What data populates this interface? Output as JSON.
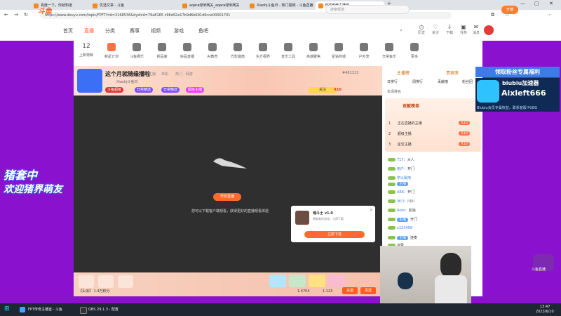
{
  "browser": {
    "tabs": [
      {
        "label": "百度一下，你就知道",
        "active": false
      },
      {
        "label": "优选文章 - 斗鱼",
        "active": false
      },
      {
        "label": "aqara绿米网关_aqara绿米网关",
        "active": false
      },
      {
        "label": "Xiaohj斗鱼日 - 热门视频 - 斗鱼直播",
        "active": false
      },
      {
        "label": "FPT传奇主播室",
        "active": true
      }
    ],
    "url": "https://www.douyu.com/topic/FPFT?rid=3168536&dyshid=79a8165 c96d92a17b9d6b691d6cce00001701"
  },
  "site": {
    "logo": "斗鱼",
    "nav": [
      "首页",
      "直播",
      "分类",
      "赛事",
      "视频",
      "游戏",
      "鱼吧"
    ],
    "nav_active": "直播",
    "search_placeholder": "搜索频道",
    "header_icons": [
      "历史",
      "关注",
      "下载",
      "任务",
      "消息"
    ],
    "open_button": "开播"
  },
  "categories": [
    {
      "top": "12",
      "label": "上新特辑"
    },
    {
      "label": "新星计划"
    },
    {
      "label": "斗鱼娱乐"
    },
    {
      "label": "新品速"
    },
    {
      "label": "好品直播"
    },
    {
      "label": "AI教育"
    },
    {
      "label": "光影盛典"
    },
    {
      "label": "东方视界"
    },
    {
      "label": "音乐工具"
    },
    {
      "label": "高端聚焦"
    },
    {
      "label": "星钻商城"
    },
    {
      "label": "户外宠"
    },
    {
      "label": "日常鱼乐"
    },
    {
      "label": "更多"
    }
  ],
  "room": {
    "title": "这个月就随缘播啦",
    "streamer": "Xiaohj斗鱼日",
    "tags": [
      "主播",
      "单机",
      "热门 · 网游"
    ],
    "badges": [
      "斗鱼超级",
      "日常精选",
      "日常精选",
      "超级主播"
    ],
    "viewer_hint": "#481113",
    "follow_label": "关注",
    "follow_count": "X10",
    "room_open_button": "开启直播",
    "player_hint": "您可以下载客户端观看，获得更好的直播观看体验",
    "popup": {
      "title": "魂斗士 v1.0",
      "desc": "勇敢者的游戏，立即下载",
      "button": "立即下载"
    },
    "gift_text": "【头衔】 1.4万积分",
    "gift_count": "1.4704",
    "fish_balls": "1.123",
    "charge_button": "充值",
    "send_button": "发送"
  },
  "side": {
    "tabs": [
      "主播榜",
      "贵宾席"
    ],
    "subtabs": [
      "日排行",
      "周排行",
      "贡献榜",
      "粉丝团"
    ],
    "rank_label": "本场排名",
    "rank_card_title": "贡献榜单",
    "rank_card_rows": [
      {
        "rank": "1",
        "name": "正在直播的主播",
        "score": "X10"
      },
      {
        "rank": "2",
        "name": "超级主播",
        "score": "X10"
      },
      {
        "rank": "3",
        "name": "星空主播",
        "score": "X10"
      }
    ],
    "chat": [
      {
        "badge": "",
        "nick": "717",
        "text": "大人"
      },
      {
        "badge": "",
        "nick": "用户",
        "text": "开门"
      },
      {
        "badge": "",
        "nick": "学以致用",
        "text": ""
      },
      {
        "badge": "主播",
        "nick": "",
        "text": ""
      },
      {
        "badge": "",
        "nick": "ARK",
        "text": "开门"
      },
      {
        "badge": "",
        "nick": "冰川",
        "text": "川川"
      },
      {
        "badge": "",
        "nick": "Aron",
        "text": "加油"
      },
      {
        "badge": "主播",
        "nick": "",
        "text": "开门"
      },
      {
        "badge": "",
        "nick": "x123456",
        "text": ""
      },
      {
        "badge": "主播",
        "nick": "",
        "text": "连麦"
      },
      {
        "badge": "",
        "nick": "",
        "text": "点赞"
      }
    ]
  },
  "overlays": {
    "fan_title": "领取粉丝专属福利",
    "fan_brand": "biubiu加速器",
    "fan_name": "Aixleft666",
    "fan_sub": "Biubiu会员专属权益，联系客服 PUBG",
    "left_line1": "猪套中",
    "left_line2": "欢迎猪界萌友",
    "right_logo": "斗鱼直播"
  },
  "taskbar": {
    "items": [
      "FPT传奇主播室 - 斗鱼",
      "OBS 29.1.3 - 配置"
    ],
    "time": "13:47",
    "date": "2023/6/10"
  }
}
